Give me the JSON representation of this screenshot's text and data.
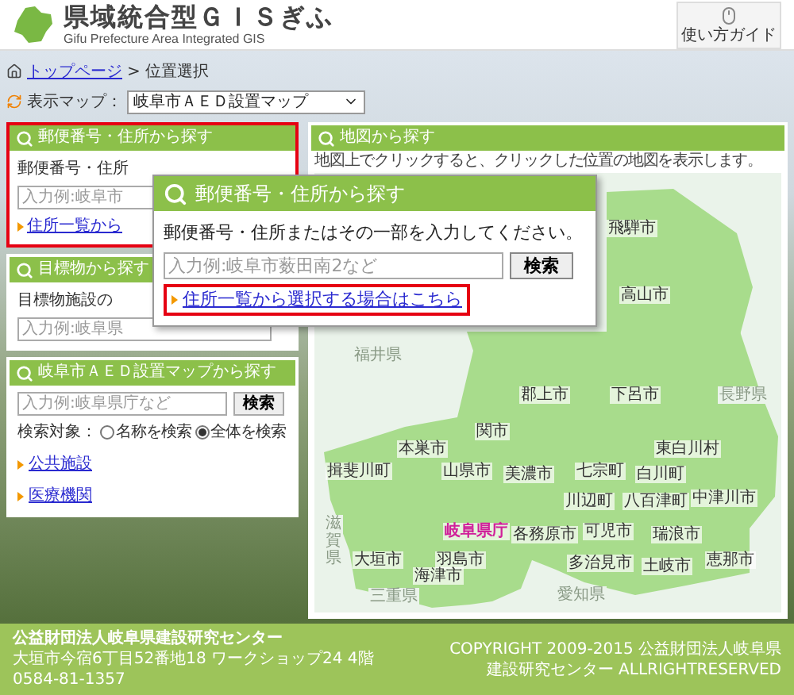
{
  "header": {
    "title": "県域統合型ＧＩＳぎふ",
    "subtitle": "Gifu Prefecture Area Integrated GIS",
    "guide_button": "使い方ガイド"
  },
  "breadcrumb": {
    "link": "トップページ",
    "current": "> 位置選択"
  },
  "map_selector": {
    "label": "表示マップ：",
    "value": "岐阜市ＡＥＤ設置マップ"
  },
  "postal_panel": {
    "title": "郵便番号・住所から探す",
    "highlighted": true,
    "text": "郵便番号・住所",
    "placeholder": "入力例:岐阜市",
    "link": "住所一覧から"
  },
  "landmark_panel": {
    "title": "目標物から探す",
    "highlighted": false,
    "text": "目標物施設の",
    "placeholder": "入力例:岐阜県"
  },
  "aed_panel": {
    "title": "岐阜市ＡＥＤ設置マップから探す",
    "highlighted": false,
    "placeholder": "入力例:岐阜県庁など",
    "search_button": "検索",
    "target_label": "検索対象：",
    "options": [
      {
        "label": "名称を検索",
        "selected": false
      },
      {
        "label": "全体を検索",
        "selected": true
      }
    ],
    "links": [
      "公共施設",
      "医療機関"
    ]
  },
  "map_panel": {
    "title": "地図から探す",
    "hint": "地図上でクリックすると、クリックした位置の地図を表示します。",
    "labels": [
      {
        "text": "飛騨市",
        "kind": "city"
      },
      {
        "text": "高山市",
        "kind": "city"
      },
      {
        "text": "福井県",
        "kind": "prefecture"
      },
      {
        "text": "郡上市",
        "kind": "city"
      },
      {
        "text": "下呂市",
        "kind": "city"
      },
      {
        "text": "長野県",
        "kind": "prefecture"
      },
      {
        "text": "関市",
        "kind": "city"
      },
      {
        "text": "本巣市",
        "kind": "city"
      },
      {
        "text": "東白川村",
        "kind": "city"
      },
      {
        "text": "揖斐川町",
        "kind": "city"
      },
      {
        "text": "山県市",
        "kind": "city"
      },
      {
        "text": "美濃市",
        "kind": "city"
      },
      {
        "text": "七宗町",
        "kind": "city"
      },
      {
        "text": "白川町",
        "kind": "city"
      },
      {
        "text": "川辺町",
        "kind": "city"
      },
      {
        "text": "八百津町",
        "kind": "city"
      },
      {
        "text": "中津川市",
        "kind": "city"
      },
      {
        "text": "滋賀県",
        "kind": "prefecture"
      },
      {
        "text": "岐阜県庁",
        "kind": "office"
      },
      {
        "text": "各務原市",
        "kind": "city"
      },
      {
        "text": "可児市",
        "kind": "city"
      },
      {
        "text": "瑞浪市",
        "kind": "city"
      },
      {
        "text": "大垣市",
        "kind": "city"
      },
      {
        "text": "羽島市",
        "kind": "city"
      },
      {
        "text": "多治見市",
        "kind": "city"
      },
      {
        "text": "土岐市",
        "kind": "city"
      },
      {
        "text": "恵那市",
        "kind": "city"
      },
      {
        "text": "海津市",
        "kind": "city"
      },
      {
        "text": "三重県",
        "kind": "prefecture"
      },
      {
        "text": "愛知県",
        "kind": "prefecture"
      }
    ]
  },
  "popup": {
    "title": "郵便番号・住所から探す",
    "text": "郵便番号・住所またはその一部を入力してください。",
    "placeholder": "入力例:岐阜市薮田南2など",
    "search_button": "検索",
    "link": "住所一覧から選択する場合はこちら"
  },
  "footer": {
    "organization": "公益財団法人岐阜県建設研究センター",
    "address": "大垣市今宿6丁目52番地18 ワークショップ24 4階　0584-81-1357",
    "copyright": "COPYRIGHT 2009-2015 公益財団法人岐阜県建設研究センター ALLRIGHTRESERVED"
  }
}
